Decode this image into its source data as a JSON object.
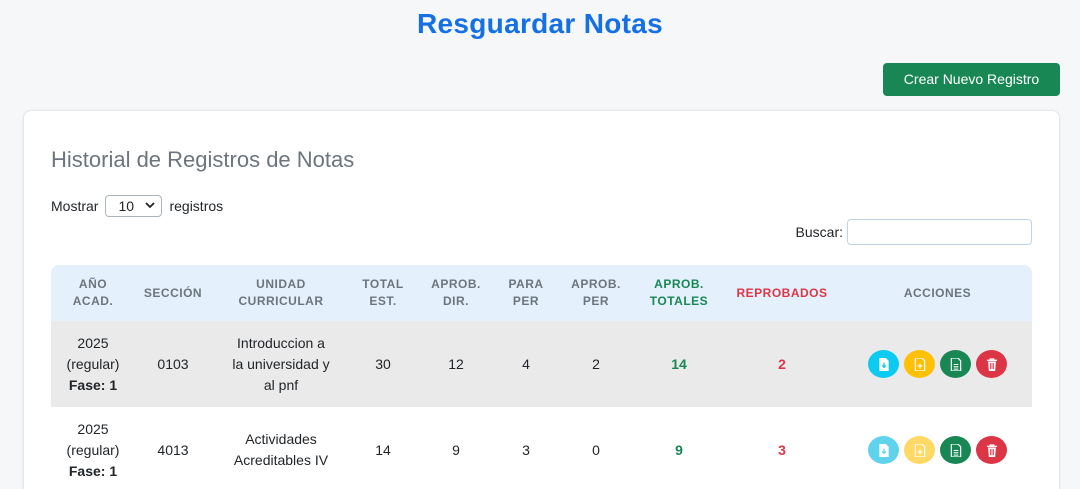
{
  "page_title": "Resguardar Notas",
  "create_button": "Crear Nuevo Registro",
  "card_title": "Historial de Registros de Notas",
  "length": {
    "prefix": "Mostrar",
    "value": "10",
    "suffix": "registros"
  },
  "search": {
    "label": "Buscar:",
    "value": ""
  },
  "table": {
    "headers": {
      "anio": [
        "AÑO",
        "ACAD."
      ],
      "seccion": "SECCIÓN",
      "unidad": [
        "UNIDAD",
        "CURRICULAR"
      ],
      "total": [
        "TOTAL",
        "EST."
      ],
      "aprob_dir": [
        "APROB.",
        "DIR."
      ],
      "para_per": [
        "PARA",
        "PER"
      ],
      "aprob_per": [
        "APROB.",
        "PER"
      ],
      "aprob_totales": [
        "APROB.",
        "TOTALES"
      ],
      "reprobados": "REPROBADOS",
      "acciones": "ACCIONES"
    },
    "rows": [
      {
        "anio": "2025",
        "tipo": "(regular)",
        "fase": "Fase: 1",
        "seccion": "0103",
        "unidad": [
          "Introduccion a",
          "la universidad y",
          "al pnf"
        ],
        "total": "30",
        "aprob_dir": "12",
        "para_per": "4",
        "aprob_per": "2",
        "aprob_totales": "14",
        "reprobados": "2"
      },
      {
        "anio": "2025",
        "tipo": "(regular)",
        "fase": "Fase: 1",
        "seccion": "4013",
        "unidad": [
          "Actividades",
          "Acreditables IV"
        ],
        "total": "14",
        "aprob_dir": "9",
        "para_per": "3",
        "aprob_per": "0",
        "aprob_totales": "9",
        "reprobados": "3"
      }
    ]
  },
  "colors": {
    "title_blue": "#1570e6",
    "success": "#198754",
    "danger": "#dc3545",
    "info": "#0dcaf0",
    "warning": "#ffc107",
    "header_bg": "#e4f0fb"
  },
  "icons": {
    "action_1": "file-download-icon",
    "action_2": "file-plus-icon",
    "action_3": "file-report-icon",
    "action_4": "trash-icon"
  }
}
